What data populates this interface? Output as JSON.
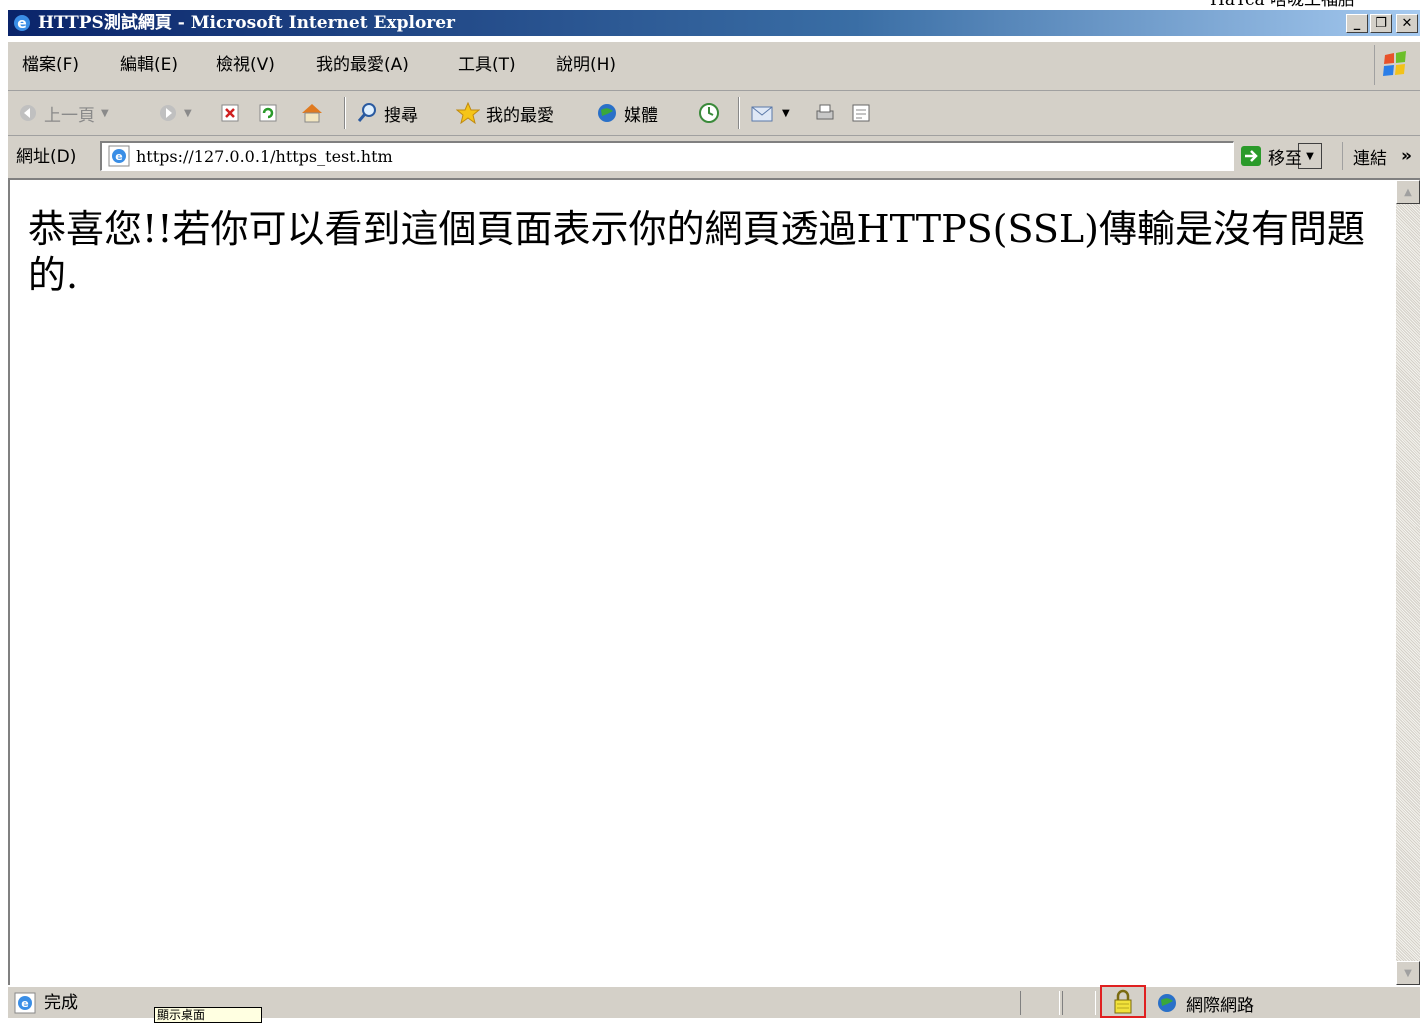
{
  "corner_text": "HaTca 啥咙工福胎",
  "window": {
    "title": "HTTPS測試網頁 - Microsoft Internet Explorer",
    "minimize": "_",
    "maximize": "❐",
    "close": "✕"
  },
  "menu": [
    "檔案(F)",
    "編輯(E)",
    "檢視(V)",
    "我的最愛(A)",
    "工具(T)",
    "說明(H)"
  ],
  "toolbar": {
    "back_label": "上一頁",
    "search_label": "搜尋",
    "favorites_label": "我的最愛",
    "media_label": "媒體"
  },
  "address": {
    "label": "網址(D)",
    "url": "https://127.0.0.1/https_test.htm",
    "go_label": "移至",
    "links_label": "連結",
    "more": "»"
  },
  "content": {
    "message": "恭喜您!!若你可以看到這個頁面表示你的網頁透過HTTPS(SSL)傳輸是沒有問題的."
  },
  "status": {
    "text": "完成",
    "tooltip": "顯示桌面",
    "zone": "網際網路"
  },
  "colors": {
    "titlebar_start": "#0a246a",
    "chrome": "#d4d0c8",
    "highlight_box": "#e02020"
  }
}
